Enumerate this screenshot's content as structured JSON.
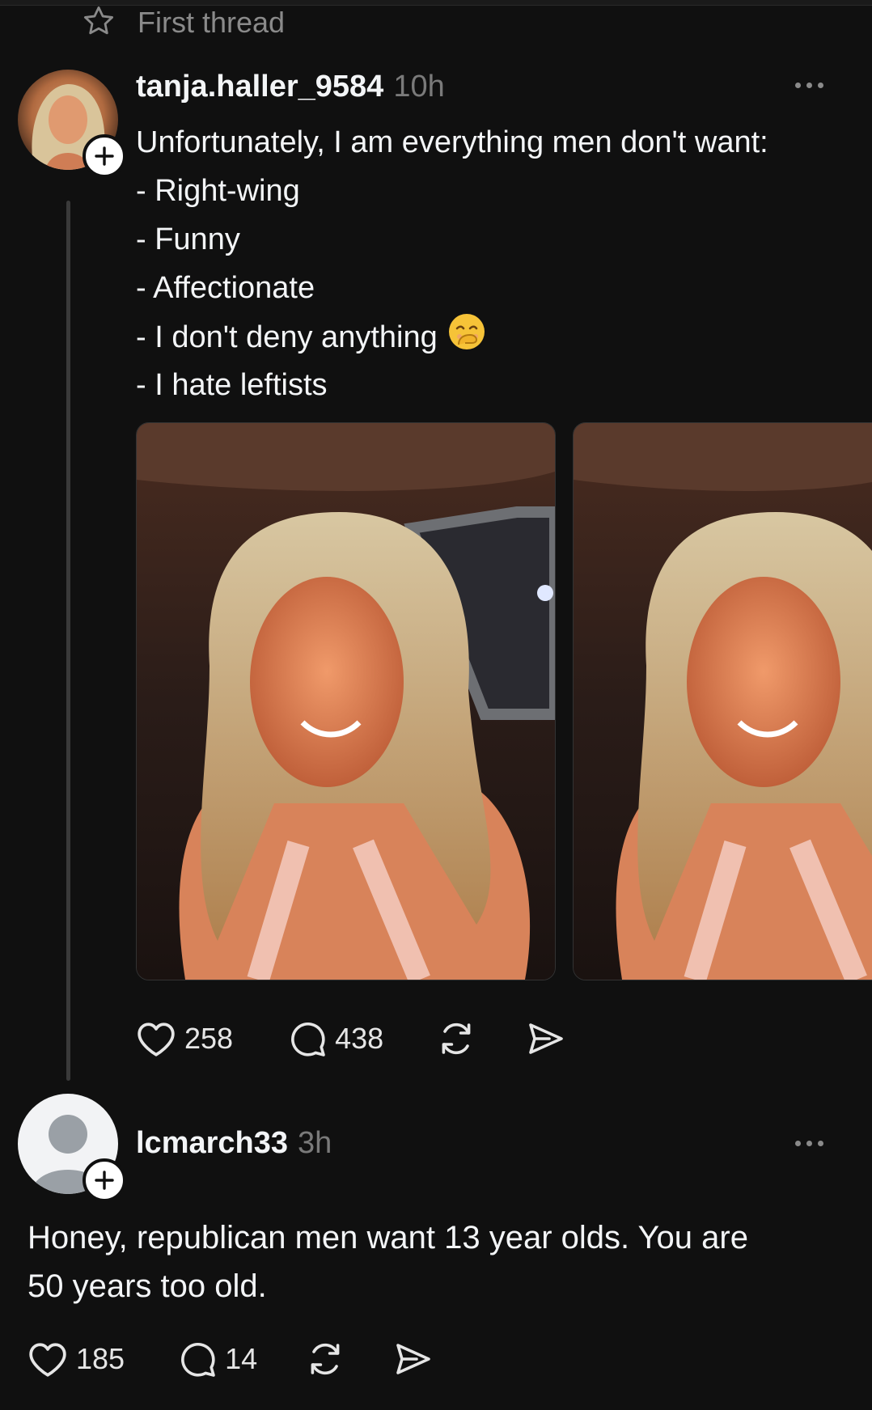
{
  "header": {
    "label": "First thread"
  },
  "post": {
    "username": "tanja.haller_9584",
    "time": "10h",
    "lines": [
      "Unfortunately, I am everything men don't want:",
      "- Right-wing",
      "- Funny",
      "- Affectionate",
      "- I don't deny anything",
      "- I hate leftists"
    ],
    "emoji": "face-with-hand-over-mouth",
    "likes": "258",
    "replies": "438"
  },
  "reply": {
    "username": "lcmarch33",
    "time": "3h",
    "text_line1": "Honey, republican men want 13 year olds. You are",
    "text_line2": "50 years too old.",
    "likes": "185",
    "replies": "14"
  },
  "colors": {
    "background": "#101010",
    "text": "#f3f5f7",
    "muted": "#7a7a7a"
  },
  "icons": [
    "star-icon",
    "plus-icon",
    "more-icon",
    "heart-icon",
    "comment-icon",
    "repost-icon",
    "share-icon"
  ]
}
